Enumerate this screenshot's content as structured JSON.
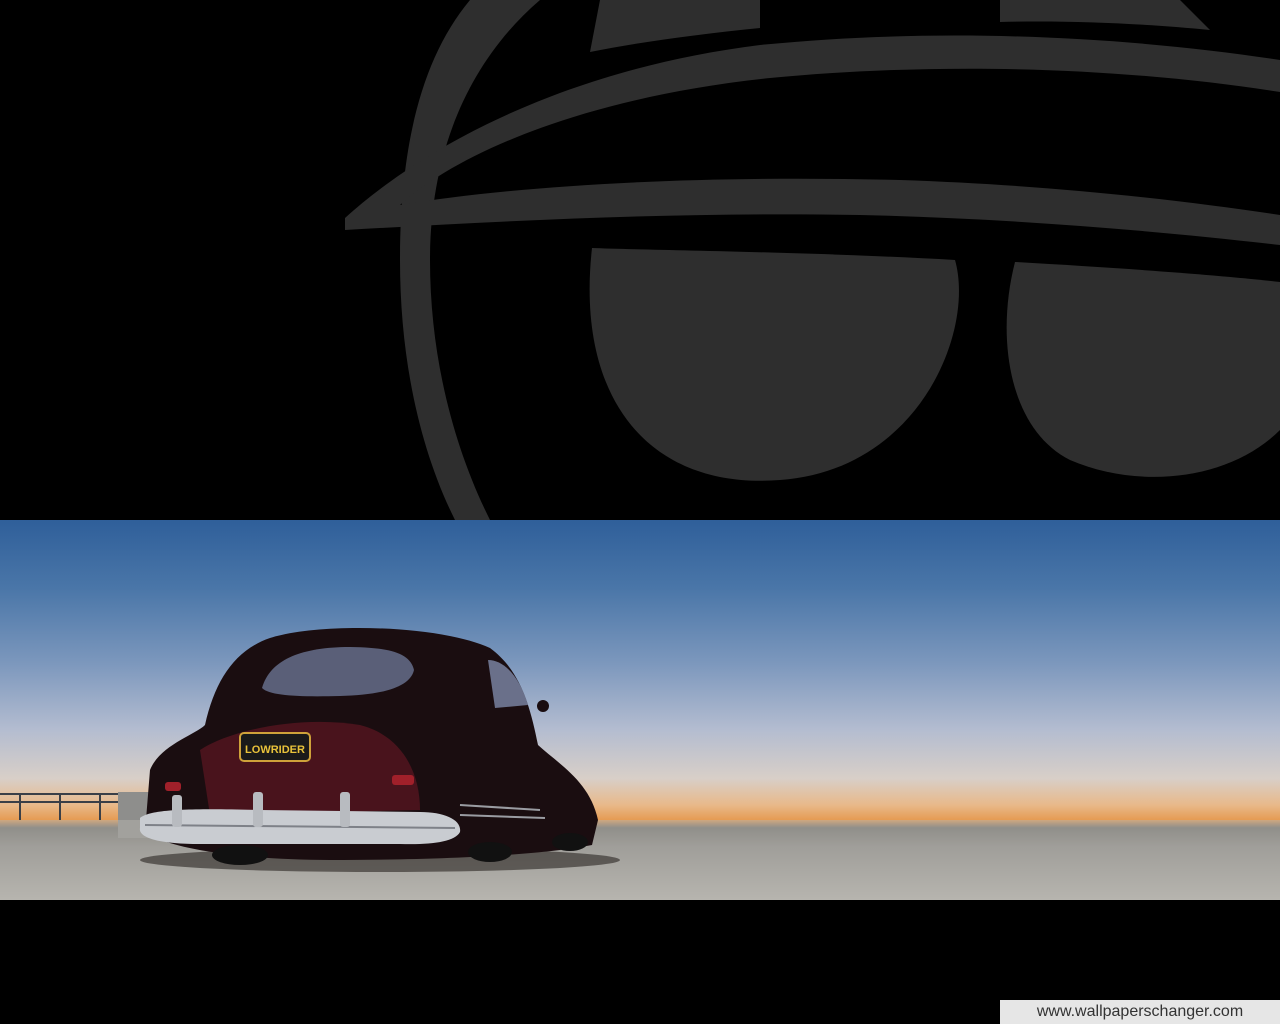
{
  "logo": {
    "icon": "sunglasses-logo-icon",
    "color": "#2e2e2e"
  },
  "photo": {
    "subject": "lowrider-car",
    "license_plate_text": "LOWRIDER",
    "sky_top_color": "#2f5f9a",
    "horizon_color": "#e59a52",
    "car_color": "#1a0d10"
  },
  "watermark": {
    "text": "www.wallpaperschanger.com"
  }
}
